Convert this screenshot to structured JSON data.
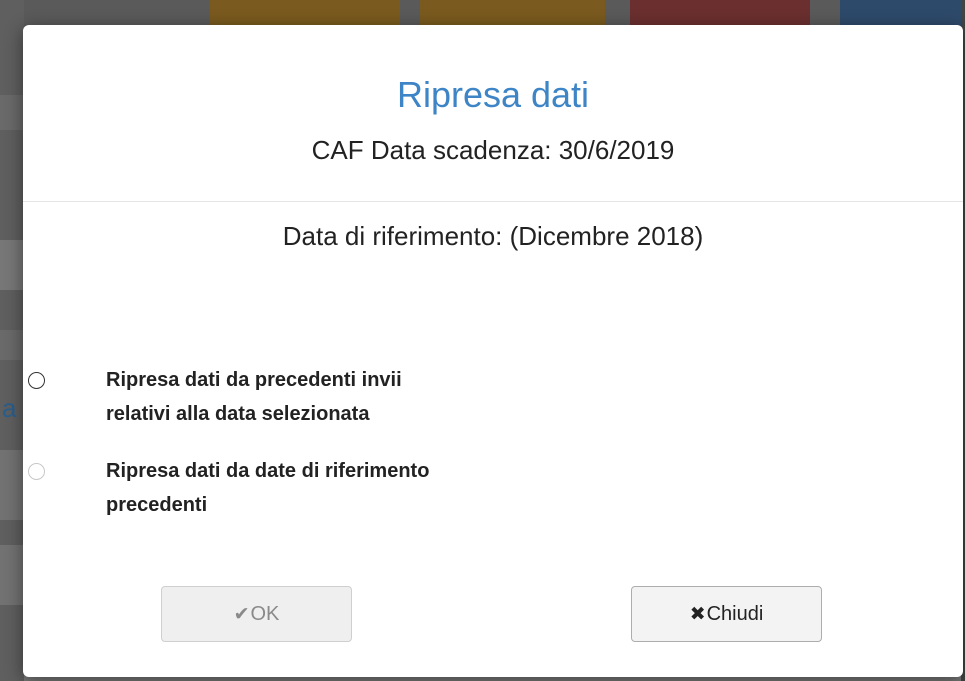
{
  "modal": {
    "title": "Ripresa dati",
    "subtitle": "CAF Data scadenza: 30/6/2019",
    "reference_date": "Data di riferimento: (Dicembre 2018)",
    "options": [
      {
        "line1": "Ripresa dati da precedenti invii",
        "line2": "relativi alla data selezionata",
        "enabled": true,
        "selected": false
      },
      {
        "line1": "Ripresa dati da date di riferimento",
        "line2": "precedenti",
        "enabled": false,
        "selected": false
      }
    ],
    "buttons": {
      "ok": {
        "icon": "check-icon",
        "label": "OK",
        "enabled": false
      },
      "close": {
        "icon": "close-icon",
        "label": "Chiudi",
        "enabled": true
      }
    }
  },
  "background": {
    "partial_letter": "a"
  },
  "colors": {
    "title": "#3d85c6",
    "overlay": "#7a7a7a"
  }
}
